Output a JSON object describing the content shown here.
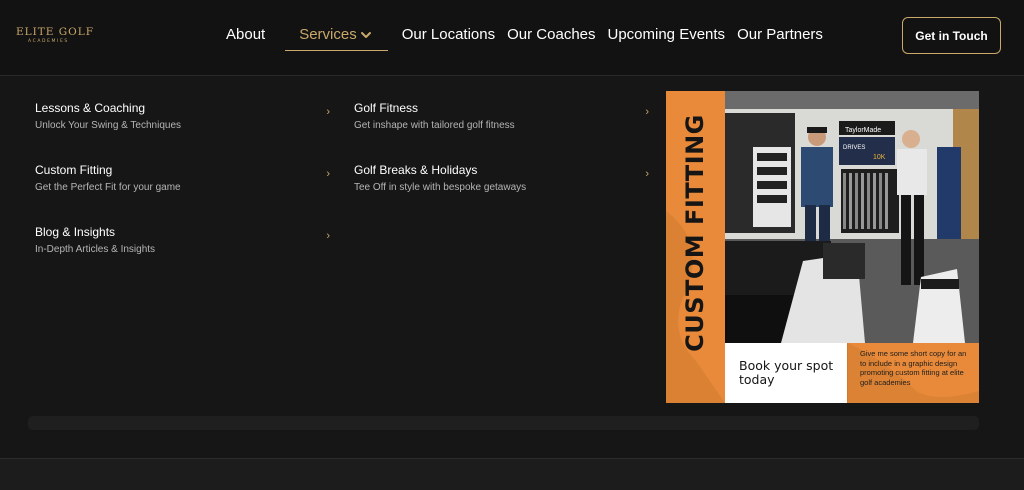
{
  "header": {
    "logo": {
      "main": "ELITE GOLF",
      "sub": "ACADEMIES"
    },
    "nav": [
      {
        "label": "About"
      },
      {
        "label": "Services",
        "active": true
      },
      {
        "label": "Our Locations"
      },
      {
        "label": "Our Coaches"
      },
      {
        "label": "Upcoming Events"
      },
      {
        "label": "Our Partners"
      }
    ],
    "cta_label": "Get in Touch"
  },
  "menu": {
    "items": [
      {
        "title": "Lessons & Coaching",
        "desc": "Unlock Your Swing & Techniques",
        "arrow": "›"
      },
      {
        "title": "Golf Fitness",
        "desc": "Get inshape with tailored golf fitness",
        "arrow": "›"
      },
      {
        "title": "Custom Fitting",
        "desc": "Get the Perfect Fit for your game",
        "arrow": "›"
      },
      {
        "title": "Golf Breaks & Holidays",
        "desc": "Tee Off in style with bespoke getaways",
        "arrow": "›"
      },
      {
        "title": "Blog & Insights",
        "desc": "In-Depth Articles & Insights",
        "arrow": "›"
      }
    ]
  },
  "promo": {
    "vertical_title": "CUSTOM FITTING",
    "box_text": "Book your spot today",
    "copy": "Give me some short copy for an to include in a graphic design promoting custom fitting at elite golf academies",
    "photo_signs": [
      "TaylorMade",
      "DRIVES",
      "10K",
      "TaylorMade"
    ]
  },
  "colors": {
    "background": "#161616",
    "header": "#121212",
    "accent_gold": "#c9a86a",
    "promo_orange": "#e88a3a",
    "text_muted": "#b5b5b5"
  },
  "icons": {
    "services_chevron": "chevron-down-icon",
    "menu_arrow": "chevron-right-icon"
  }
}
